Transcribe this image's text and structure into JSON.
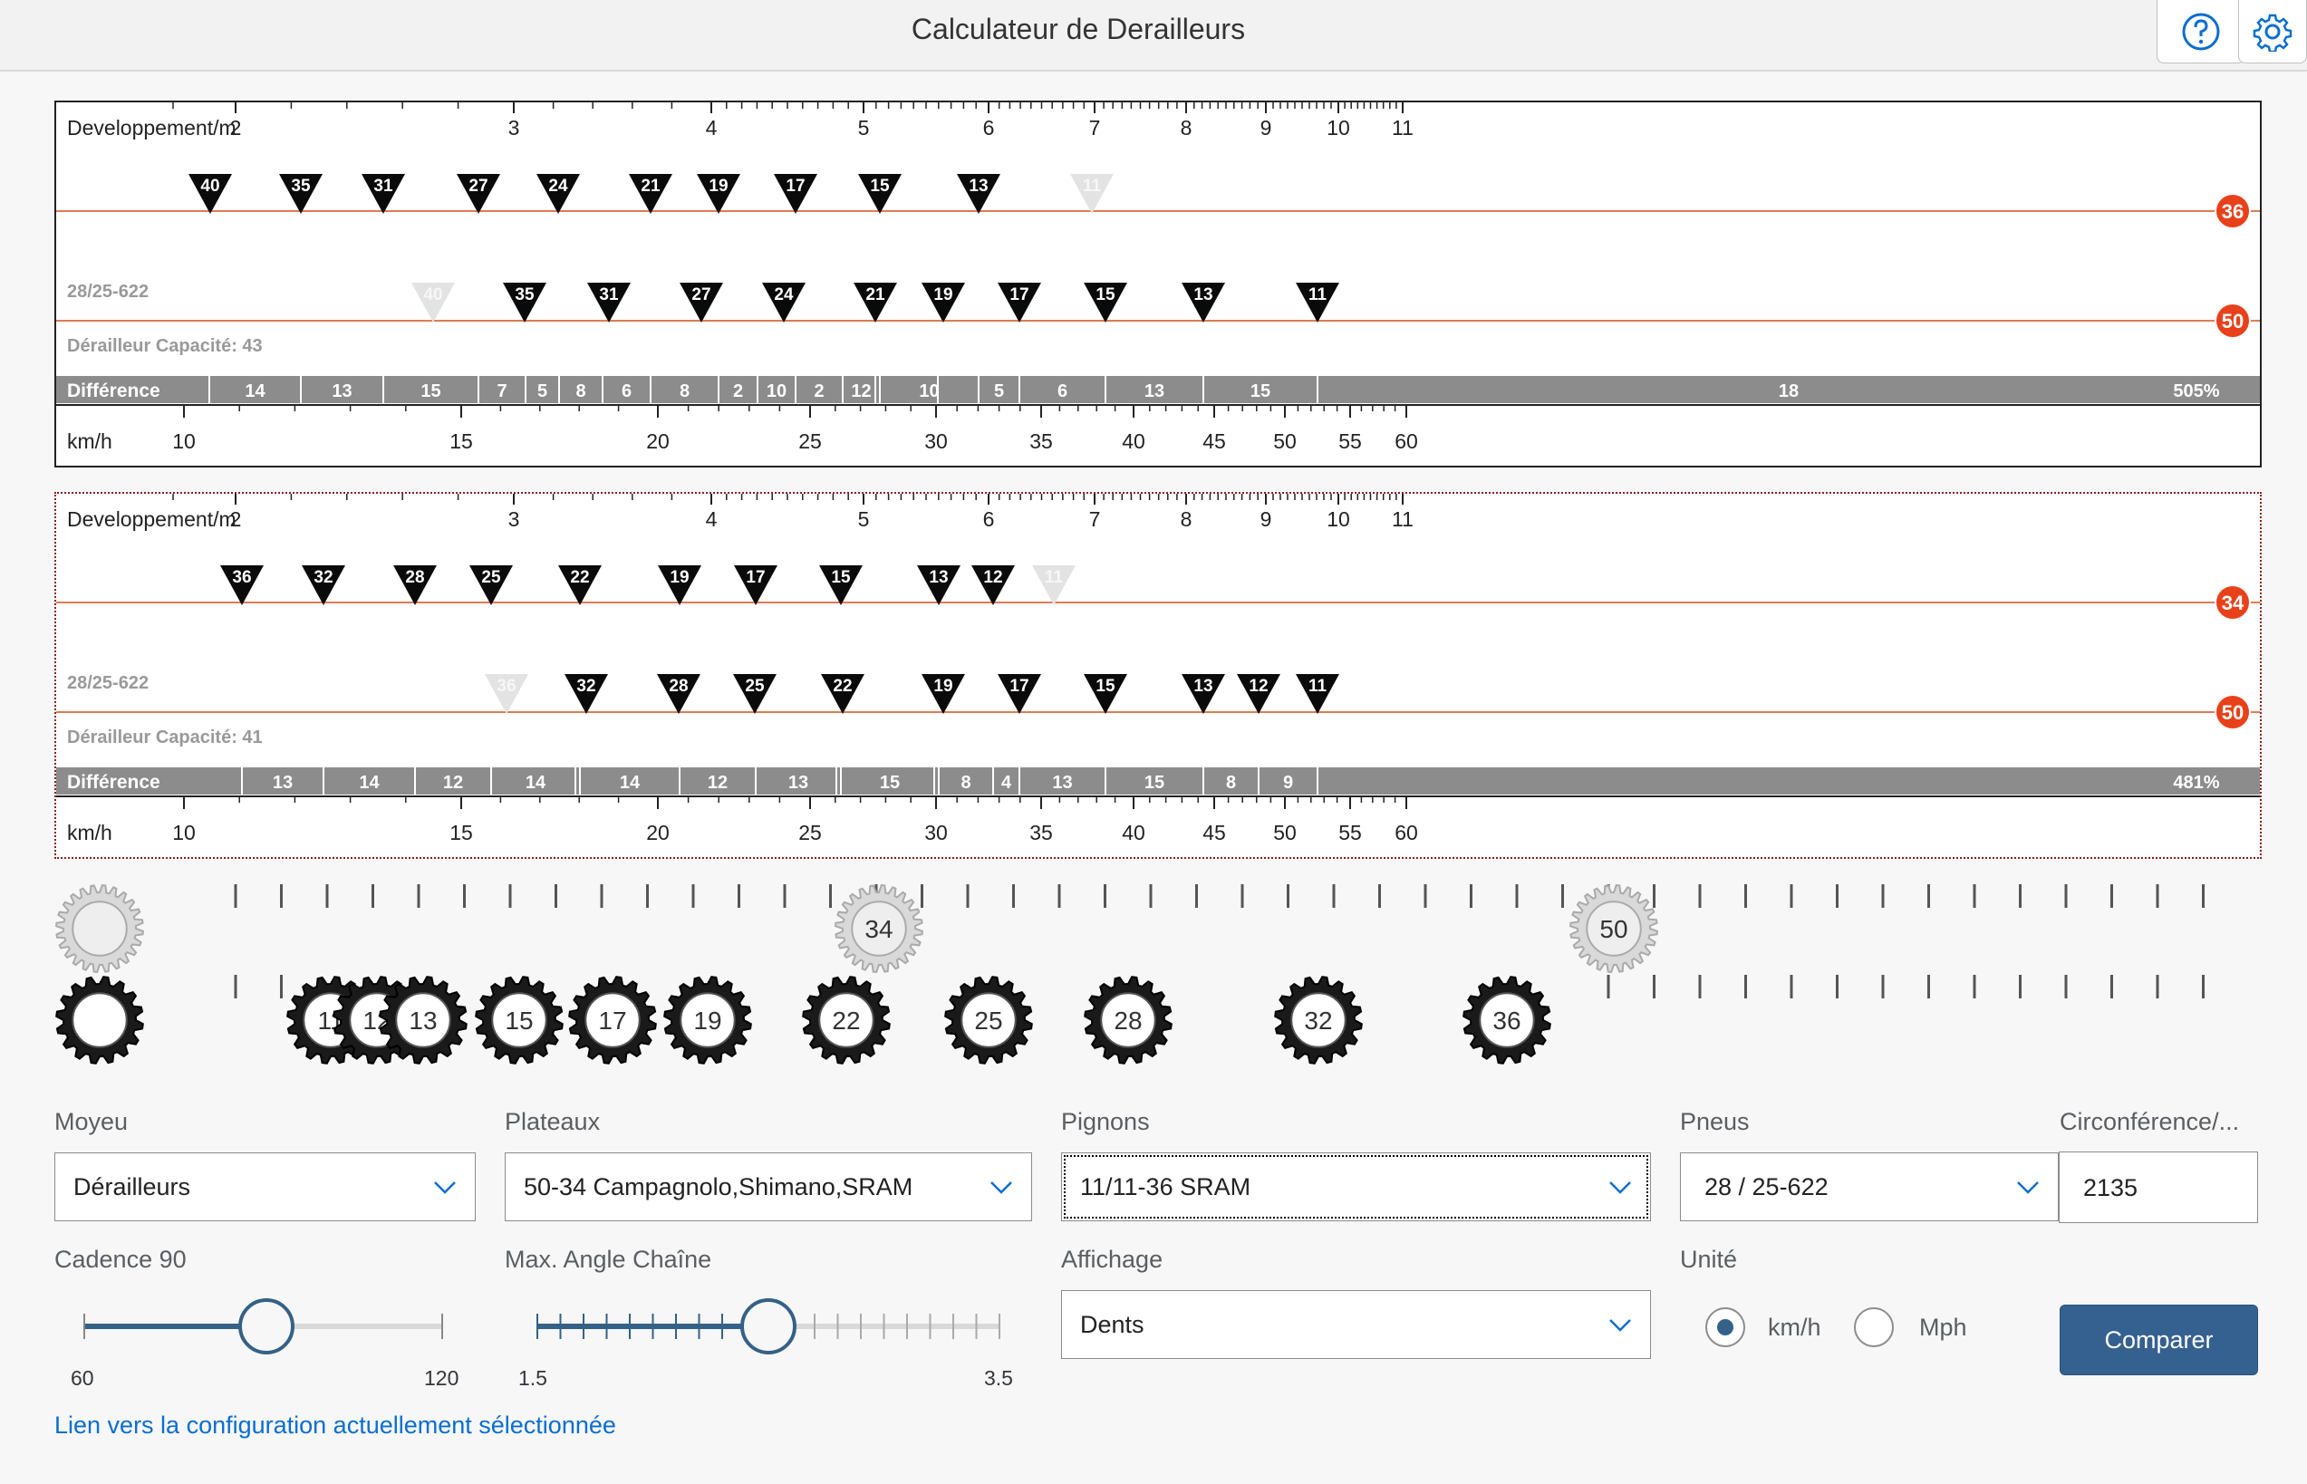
{
  "app": {
    "title": "Calculateur de Derailleurs"
  },
  "scale": {
    "dev_label": "Developpement/m",
    "dev_ticks": [
      "2",
      "3",
      "4",
      "5",
      "6",
      "7",
      "8",
      "9",
      "10",
      "11"
    ],
    "speed_label": "km/h",
    "speed_ticks": [
      "10",
      "15",
      "20",
      "25",
      "30",
      "35",
      "40",
      "45",
      "50",
      "55",
      "60"
    ]
  },
  "panels": [
    {
      "tire_label": "28/25-622",
      "capacity_label": "Dérailleur Capacité: 43",
      "diff_label": "Différence",
      "chainring_small": "36",
      "chainring_large": "50",
      "small_ring_cogs": [
        "40",
        "35",
        "31",
        "27",
        "24",
        "21",
        "19",
        "17",
        "15",
        "13",
        "11"
      ],
      "large_ring_cogs": [
        "40",
        "35",
        "31",
        "27",
        "24",
        "21",
        "19",
        "17",
        "15",
        "13",
        "11"
      ],
      "diff_values": [
        "14",
        "13",
        "15",
        "7",
        "5",
        "8",
        "6",
        "8",
        "2",
        "10",
        "2",
        "12",
        "10",
        "5",
        "6",
        "13",
        "15",
        "18",
        "505%"
      ]
    },
    {
      "tire_label": "28/25-622",
      "capacity_label": "Dérailleur Capacité: 41",
      "diff_label": "Différence",
      "chainring_small": "34",
      "chainring_large": "50",
      "small_ring_cogs": [
        "36",
        "32",
        "28",
        "25",
        "22",
        "19",
        "17",
        "15",
        "13",
        "12",
        "11"
      ],
      "large_ring_cogs": [
        "36",
        "32",
        "28",
        "25",
        "22",
        "19",
        "17",
        "15",
        "13",
        "12",
        "11"
      ],
      "diff_values": [
        "13",
        "14",
        "12",
        "14",
        "14",
        "12",
        "13",
        "15",
        "8",
        "4",
        "13",
        "15",
        "8",
        "9",
        "481%"
      ]
    }
  ],
  "chainring_labels": [
    "34",
    "50"
  ],
  "cog_labels": [
    "11",
    "12",
    "13",
    "15",
    "17",
    "19",
    "22",
    "25",
    "28",
    "32",
    "36"
  ],
  "form": {
    "moyeu": {
      "label": "Moyeu",
      "value": "Dérailleurs"
    },
    "plateaux": {
      "label": "Plateaux",
      "value": "50-34 Campagnolo,Shimano,SRAM"
    },
    "pignons": {
      "label": "Pignons",
      "value": "11/11-36 SRAM"
    },
    "pneus": {
      "label": "Pneus",
      "value": "28 / 25-622"
    },
    "circonference": {
      "label": "Circonférence/...",
      "value": "2135"
    },
    "cadence": {
      "label": "Cadence 90",
      "min": "60",
      "max": "120",
      "value": 90
    },
    "angle": {
      "label": "Max. Angle Chaîne",
      "min": "1.5",
      "max": "3.5",
      "value": 2.5
    },
    "affichage": {
      "label": "Affichage",
      "value": "Dents"
    },
    "unite": {
      "label": "Unité",
      "options": [
        "km/h",
        "Mph"
      ],
      "selected": "km/h"
    },
    "compare_button": "Comparer",
    "link": "Lien vers la configuration actuellement sélectionnée"
  },
  "colors": {
    "accent": "#356190",
    "gear_line": "#e07a52",
    "ring_badge": "#e8411a",
    "diff_bar": "#8c8c8c"
  }
}
